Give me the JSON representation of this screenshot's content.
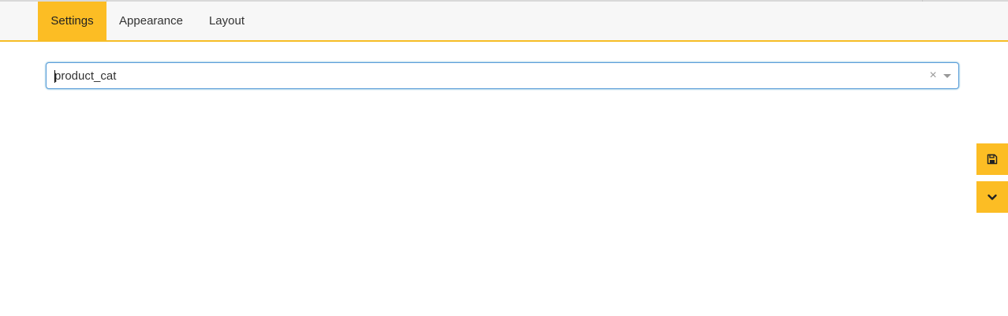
{
  "tabs": [
    {
      "label": "Settings",
      "active": true
    },
    {
      "label": "Appearance",
      "active": false
    },
    {
      "label": "Layout",
      "active": false
    }
  ],
  "select": {
    "value": "product_cat",
    "clear_symbol": "×"
  },
  "side_buttons": {
    "save_icon": "floppy-disk-icon",
    "collapse_icon": "chevron-down-icon"
  },
  "colors": {
    "accent": "#fcbd24",
    "focus_border": "#5b9dd9",
    "tabbar_bg": "#f7f7f7"
  }
}
